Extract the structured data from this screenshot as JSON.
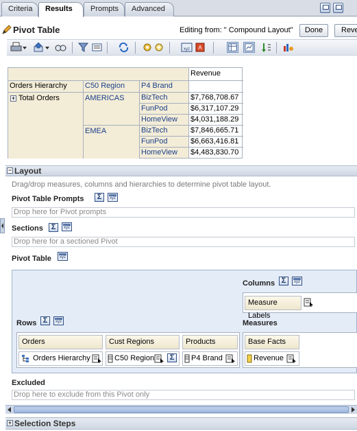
{
  "tabs": [
    {
      "label": "Criteria",
      "active": false
    },
    {
      "label": "Results",
      "active": true
    },
    {
      "label": "Prompts",
      "active": false
    },
    {
      "label": "Advanced",
      "active": false
    }
  ],
  "header": {
    "title": "Pivot Table",
    "editing_text": "Editing from: \" Compound Layout\"",
    "done_label": "Done",
    "revert_label": "Reve"
  },
  "toolbar": {
    "icons": [
      "print-icon",
      "export-icon",
      "find-icon",
      "filter-icon",
      "format-icon",
      "refresh-icon",
      "add-view-icon",
      "new-calc-icon",
      "xyz-icon",
      "remove-icon",
      "table-view-icon",
      "graph-view-icon",
      "sort-icon",
      "chart-icon"
    ]
  },
  "pivot_table": {
    "measure_header": "Revenue",
    "col_headers": [
      "Orders Hierarchy",
      "C50 Region",
      "P4 Brand"
    ],
    "total_label": "Total Orders",
    "regions": [
      {
        "name": "AMERICAS",
        "rows": [
          {
            "brand": "BizTech",
            "revenue": "$7,768,708.67"
          },
          {
            "brand": "FunPod",
            "revenue": "$6,317,107.29"
          },
          {
            "brand": "HomeView",
            "revenue": "$4,031,188.29"
          }
        ]
      },
      {
        "name": "EMEA",
        "rows": [
          {
            "brand": "BizTech",
            "revenue": "$7,846,665.71"
          },
          {
            "brand": "FunPod",
            "revenue": "$6,663,416.81"
          },
          {
            "brand": "HomeView",
            "revenue": "$4,483,830.70"
          }
        ]
      }
    ]
  },
  "layout": {
    "section_label": "Layout",
    "help_text": "Drag/drop measures, columns and hierarchies to determine pivot table layout.",
    "prompts_label": "Pivot Table Prompts",
    "prompts_drop": "Drop here for Pivot prompts",
    "sections_label": "Sections",
    "sections_drop": "Drop here for a sectioned Pivot",
    "pivot_label": "Pivot Table",
    "columns_label": "Columns",
    "measure_labels": "Measure Labels",
    "rows_label": "Rows",
    "measures_label": "Measures",
    "rows": [
      {
        "header": "Orders",
        "item": "Orders Hierarchy"
      },
      {
        "header": "Cust Regions",
        "item": "C50 Region"
      },
      {
        "header": "Products",
        "item": "P4 Brand"
      }
    ],
    "measures": {
      "header": "Base Facts",
      "item": "Revenue"
    },
    "excluded_label": "Excluded",
    "excluded_drop": "Drop here to exclude from this Pivot only"
  },
  "selection_steps": {
    "label": "Selection Steps"
  },
  "colors": {
    "accent": "#1a3f8a",
    "header_bg": "#f3ecd7",
    "area_bg": "#e4ecf7"
  }
}
